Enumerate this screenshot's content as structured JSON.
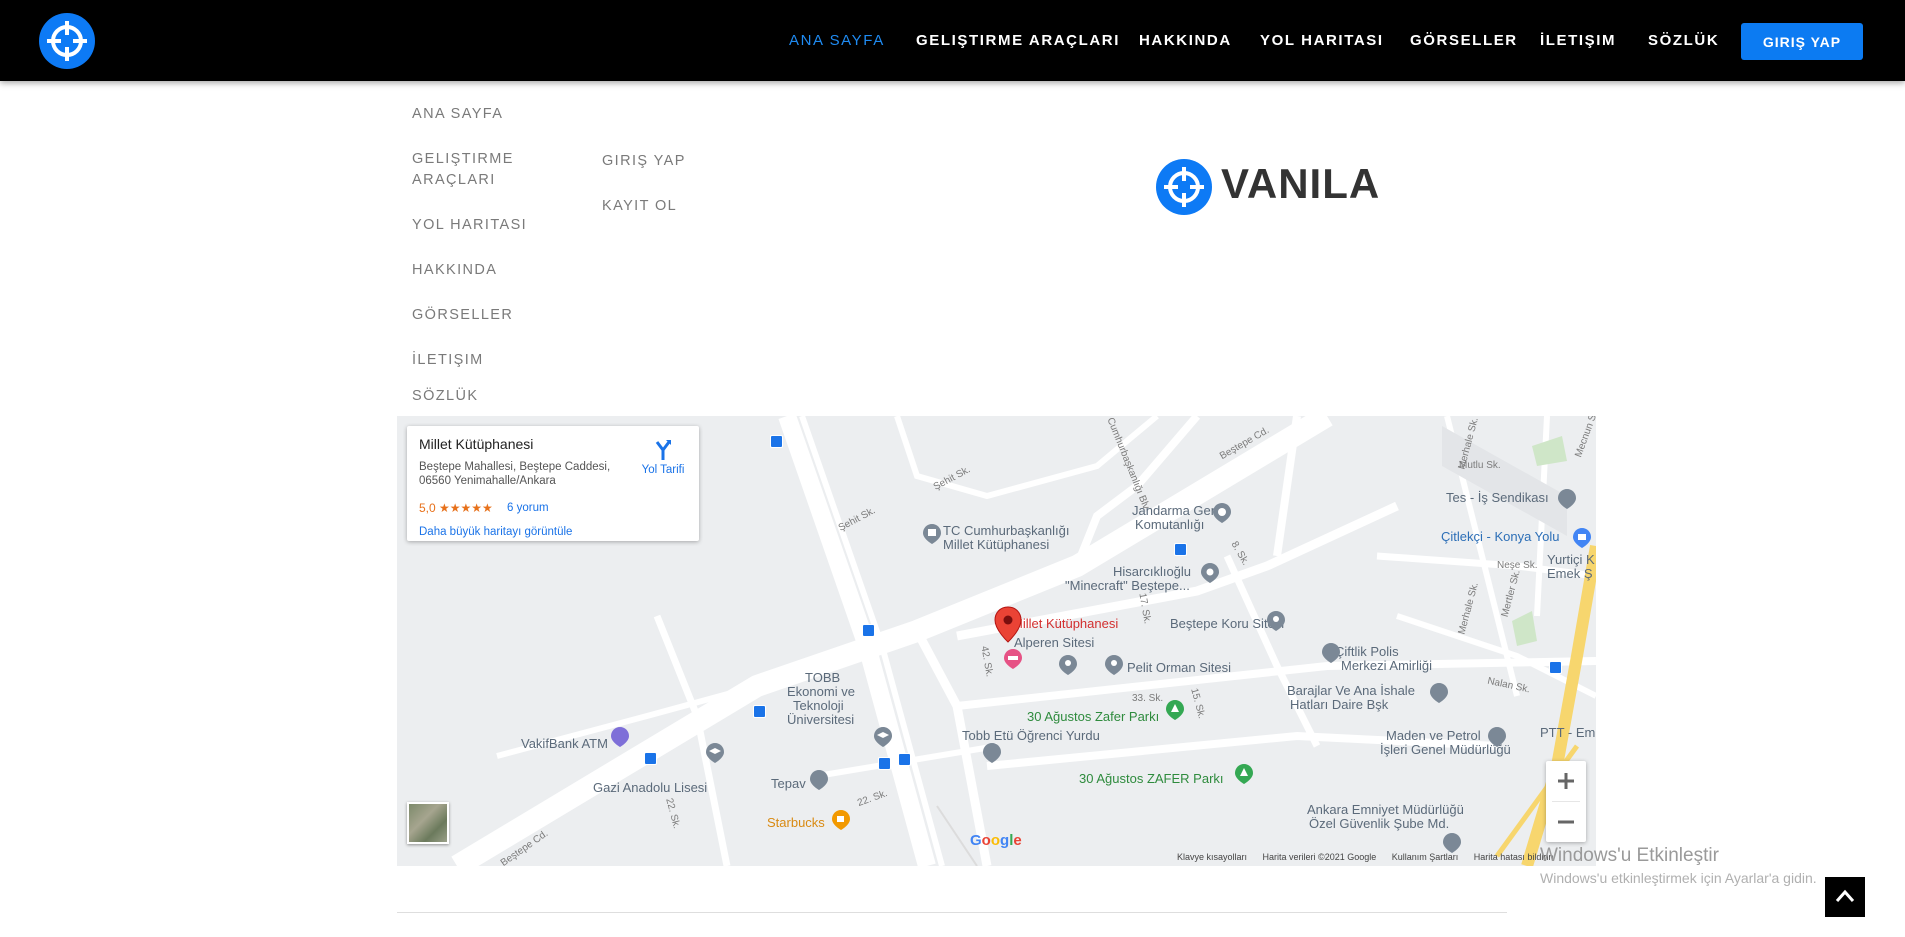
{
  "navbar": {
    "links": [
      "ANA SAYFA",
      "GELIŞTIRME ARAÇLARI",
      "HAKKINDA",
      "YOL HARITASI",
      "GÖRSELLER",
      "İLETIŞIM",
      "SÖZLÜK"
    ],
    "login": "GIRIŞ YAP",
    "accent": "#0c7bf2"
  },
  "footer": {
    "col1": [
      "ANA SAYFA",
      "GELIŞTIRME",
      "ARAÇLARI",
      "YOL HARITASI",
      "HAKKINDA",
      "GÖRSELLER",
      "İLETIŞIM",
      "SÖZLÜK"
    ],
    "col2": [
      "GIRIŞ YAP",
      "KAYIT OL"
    ],
    "brand": "VANILA"
  },
  "map": {
    "card": {
      "title": "Millet Kütüphanesi",
      "address": "Beştepe Mahallesi, Beştepe Caddesi, 06560 Yenimahalle/Ankara",
      "rating": "5,0 ★★★★★",
      "reviews": "6 yorum",
      "directions": "Yol Tarifi",
      "bigger_map": "Daha büyük haritayı görüntüle"
    },
    "labels": {
      "cumhur1": "TC Cumhurbaşkanlığı",
      "cumhur2": "Millet Kütüphanesi",
      "jandarma1": "Jandarma Genel",
      "jandarma2": "Komutanlığı",
      "tes": "Tes - İş Sendikası",
      "ciftlikci": "Çitlekçi - Konya Yolu",
      "yurtici1": "Yurtiçi K",
      "yurtici2": "Emek Ş",
      "hisar1": "Hisarcıklıoğlu",
      "hisar2": "\"Minecraft\" Beştepe...",
      "millet_pin": "Millet Kütüphanesi",
      "alperen": "Alperen Sitesi",
      "pelit": "Pelit Orman Sitesi",
      "koru": "Beştepe Koru Sitesi",
      "ciftlik1": "Çiftlik Polis",
      "ciftlik2": "Merkezi Amirliği",
      "barajlar1": "Barajlar Ve Ana İshale",
      "barajlar2": "Hatları Daire Bşk",
      "tobb1": "TOBB",
      "tobb2": "Ekonomi ve",
      "tobb3": "Teknoloji",
      "tobb4": "Üniversitesi",
      "zafer": "30 Ağustos Zafer Parkı",
      "zafer2": "30 Ağustos ZAFER Parkı",
      "tobbetu": "Tobb Etü Öğrenci Yurdu",
      "maden1": "Maden ve Petrol",
      "maden2": "İşleri Genel Müdürlüğü",
      "ptt": "PTT - Em",
      "vakif": "VakifBank ATM",
      "gazi": "Gazi Anadolu Lisesi",
      "tepav": "Tepav",
      "starbucks": "Starbucks",
      "emniyet1": "Ankara Emniyet Müdürlüğü",
      "emniyet2": "Özel Güvenlik Şube Md.",
      "google": "Google",
      "s_besteped": "Beştepe Cd.",
      "s_cumhur": "Cumhurbaşkanlığı Blv",
      "s_sehit": "Şehit Sk.",
      "s_sehit2": "Şehit Sk.",
      "s_mutlu": "Mutlu Sk.",
      "s_nese": "Neşe Sk.",
      "s_nalan": "Nalan Sk.",
      "s_mehale": "Merhale Sk.",
      "s_mertler": "Mertler Sk.",
      "s_8": "8. Sk.",
      "s_17": "17. Sk.",
      "s_42": "42. Sk.",
      "s_33": "33. Sk.",
      "s_15": "15. Sk.",
      "s_22a": "22. Sk.",
      "s_22b": "22. Sk.",
      "s_besteped2": "Beştepe Cd.",
      "s_mecnun": "Mecnun Sk"
    },
    "footer": [
      "Klavye kısayolları",
      "Harita verileri ©2021 Google",
      "Kullanım Şartları",
      "Harita hatası bildirin"
    ]
  },
  "windows": {
    "title": "Windows'u Etkinleştir",
    "subtitle": "Windows'u etkinleştirmek için Ayarlar'a gidin."
  }
}
